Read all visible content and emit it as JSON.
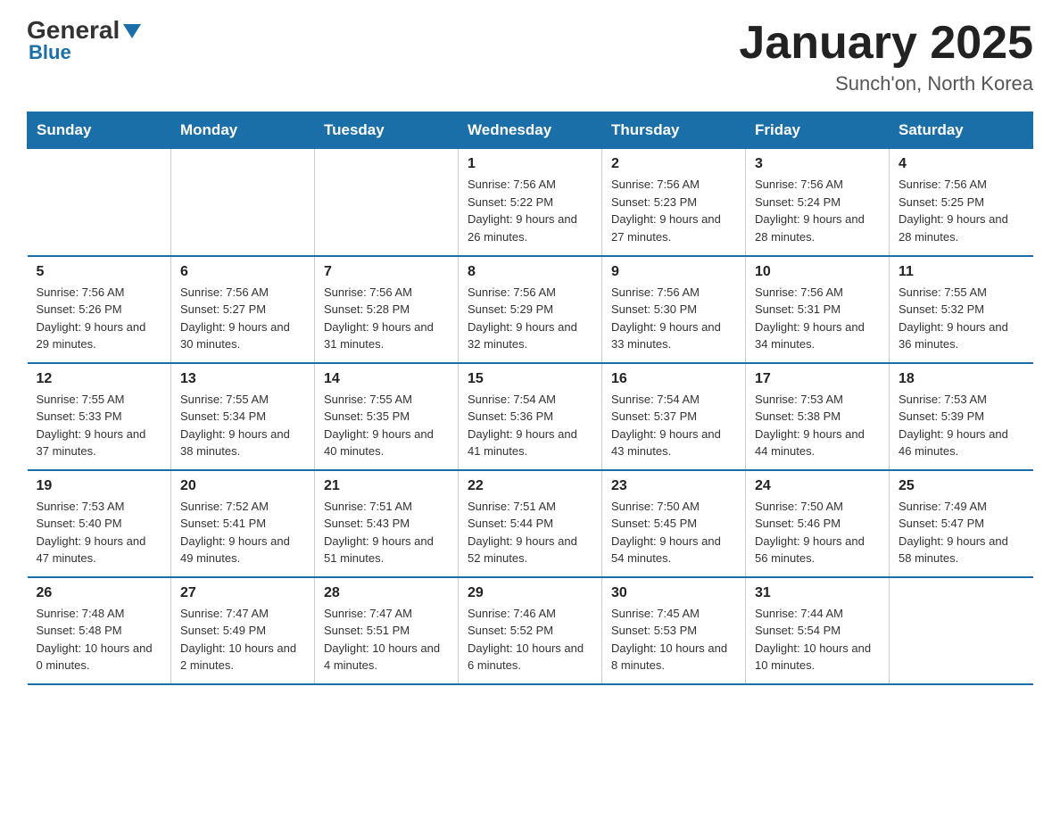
{
  "logo": {
    "general": "General",
    "blue": "Blue"
  },
  "title": "January 2025",
  "location": "Sunch'on, North Korea",
  "days_of_week": [
    "Sunday",
    "Monday",
    "Tuesday",
    "Wednesday",
    "Thursday",
    "Friday",
    "Saturday"
  ],
  "weeks": [
    [
      {
        "day": "",
        "info": ""
      },
      {
        "day": "",
        "info": ""
      },
      {
        "day": "",
        "info": ""
      },
      {
        "day": "1",
        "info": "Sunrise: 7:56 AM\nSunset: 5:22 PM\nDaylight: 9 hours and 26 minutes."
      },
      {
        "day": "2",
        "info": "Sunrise: 7:56 AM\nSunset: 5:23 PM\nDaylight: 9 hours and 27 minutes."
      },
      {
        "day": "3",
        "info": "Sunrise: 7:56 AM\nSunset: 5:24 PM\nDaylight: 9 hours and 28 minutes."
      },
      {
        "day": "4",
        "info": "Sunrise: 7:56 AM\nSunset: 5:25 PM\nDaylight: 9 hours and 28 minutes."
      }
    ],
    [
      {
        "day": "5",
        "info": "Sunrise: 7:56 AM\nSunset: 5:26 PM\nDaylight: 9 hours and 29 minutes."
      },
      {
        "day": "6",
        "info": "Sunrise: 7:56 AM\nSunset: 5:27 PM\nDaylight: 9 hours and 30 minutes."
      },
      {
        "day": "7",
        "info": "Sunrise: 7:56 AM\nSunset: 5:28 PM\nDaylight: 9 hours and 31 minutes."
      },
      {
        "day": "8",
        "info": "Sunrise: 7:56 AM\nSunset: 5:29 PM\nDaylight: 9 hours and 32 minutes."
      },
      {
        "day": "9",
        "info": "Sunrise: 7:56 AM\nSunset: 5:30 PM\nDaylight: 9 hours and 33 minutes."
      },
      {
        "day": "10",
        "info": "Sunrise: 7:56 AM\nSunset: 5:31 PM\nDaylight: 9 hours and 34 minutes."
      },
      {
        "day": "11",
        "info": "Sunrise: 7:55 AM\nSunset: 5:32 PM\nDaylight: 9 hours and 36 minutes."
      }
    ],
    [
      {
        "day": "12",
        "info": "Sunrise: 7:55 AM\nSunset: 5:33 PM\nDaylight: 9 hours and 37 minutes."
      },
      {
        "day": "13",
        "info": "Sunrise: 7:55 AM\nSunset: 5:34 PM\nDaylight: 9 hours and 38 minutes."
      },
      {
        "day": "14",
        "info": "Sunrise: 7:55 AM\nSunset: 5:35 PM\nDaylight: 9 hours and 40 minutes."
      },
      {
        "day": "15",
        "info": "Sunrise: 7:54 AM\nSunset: 5:36 PM\nDaylight: 9 hours and 41 minutes."
      },
      {
        "day": "16",
        "info": "Sunrise: 7:54 AM\nSunset: 5:37 PM\nDaylight: 9 hours and 43 minutes."
      },
      {
        "day": "17",
        "info": "Sunrise: 7:53 AM\nSunset: 5:38 PM\nDaylight: 9 hours and 44 minutes."
      },
      {
        "day": "18",
        "info": "Sunrise: 7:53 AM\nSunset: 5:39 PM\nDaylight: 9 hours and 46 minutes."
      }
    ],
    [
      {
        "day": "19",
        "info": "Sunrise: 7:53 AM\nSunset: 5:40 PM\nDaylight: 9 hours and 47 minutes."
      },
      {
        "day": "20",
        "info": "Sunrise: 7:52 AM\nSunset: 5:41 PM\nDaylight: 9 hours and 49 minutes."
      },
      {
        "day": "21",
        "info": "Sunrise: 7:51 AM\nSunset: 5:43 PM\nDaylight: 9 hours and 51 minutes."
      },
      {
        "day": "22",
        "info": "Sunrise: 7:51 AM\nSunset: 5:44 PM\nDaylight: 9 hours and 52 minutes."
      },
      {
        "day": "23",
        "info": "Sunrise: 7:50 AM\nSunset: 5:45 PM\nDaylight: 9 hours and 54 minutes."
      },
      {
        "day": "24",
        "info": "Sunrise: 7:50 AM\nSunset: 5:46 PM\nDaylight: 9 hours and 56 minutes."
      },
      {
        "day": "25",
        "info": "Sunrise: 7:49 AM\nSunset: 5:47 PM\nDaylight: 9 hours and 58 minutes."
      }
    ],
    [
      {
        "day": "26",
        "info": "Sunrise: 7:48 AM\nSunset: 5:48 PM\nDaylight: 10 hours and 0 minutes."
      },
      {
        "day": "27",
        "info": "Sunrise: 7:47 AM\nSunset: 5:49 PM\nDaylight: 10 hours and 2 minutes."
      },
      {
        "day": "28",
        "info": "Sunrise: 7:47 AM\nSunset: 5:51 PM\nDaylight: 10 hours and 4 minutes."
      },
      {
        "day": "29",
        "info": "Sunrise: 7:46 AM\nSunset: 5:52 PM\nDaylight: 10 hours and 6 minutes."
      },
      {
        "day": "30",
        "info": "Sunrise: 7:45 AM\nSunset: 5:53 PM\nDaylight: 10 hours and 8 minutes."
      },
      {
        "day": "31",
        "info": "Sunrise: 7:44 AM\nSunset: 5:54 PM\nDaylight: 10 hours and 10 minutes."
      },
      {
        "day": "",
        "info": ""
      }
    ]
  ]
}
